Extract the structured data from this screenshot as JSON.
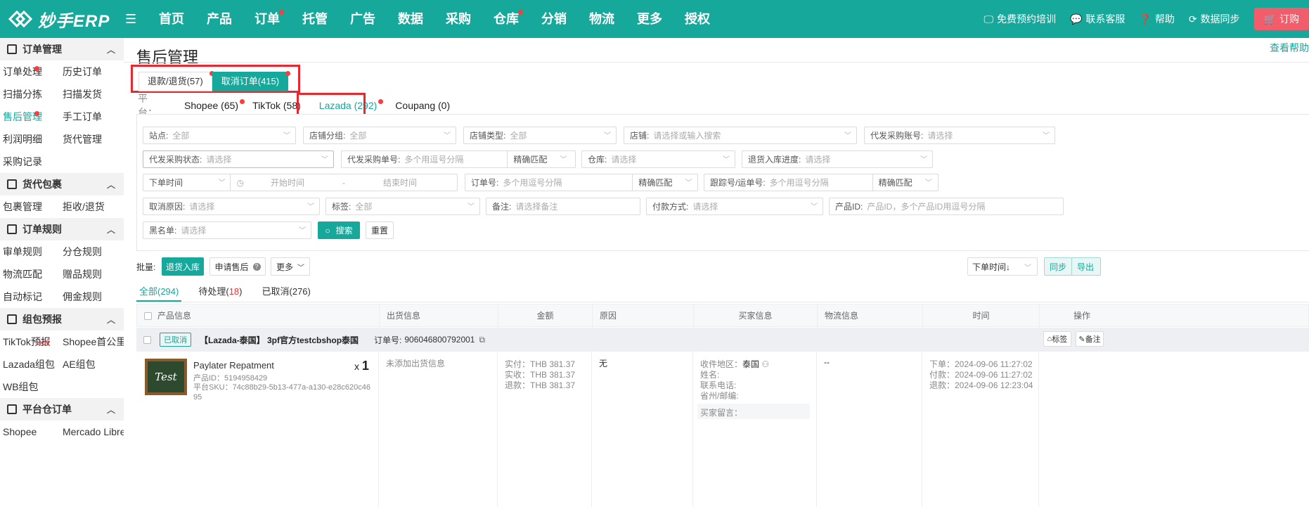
{
  "app": {
    "logo_text": "妙手ERP"
  },
  "nav": [
    "首页",
    "产品",
    "订单",
    "托管",
    "广告",
    "数据",
    "采购",
    "仓库",
    "分销",
    "物流",
    "更多",
    "授权"
  ],
  "top_right": {
    "training": "免费预约培训",
    "service": "联系客服",
    "help": "帮助",
    "sync": "数据同步",
    "order": "订购"
  },
  "sidebar": {
    "sections": [
      {
        "title": "订单管理",
        "items": [
          "订单处理",
          "历史订单",
          "扫描分拣",
          "扫描发货",
          "售后管理",
          "手工订单",
          "利润明细",
          "货代管理",
          "采购记录"
        ]
      },
      {
        "title": "货代包裹",
        "items": [
          "包裹管理",
          "拒收/退货"
        ]
      },
      {
        "title": "订单规则",
        "items": [
          "审单规则",
          "分仓规则",
          "物流匹配",
          "赠品规则",
          "自动标记",
          "佣金规则"
        ]
      },
      {
        "title": "组包预报",
        "items": [
          "TikTok预报",
          "Shopee首公里",
          "Lazada组包",
          "AE组包",
          "WB组包"
        ]
      },
      {
        "title": "平台仓订单",
        "items": [
          "Shopee",
          "Mercado Libre"
        ]
      }
    ],
    "hot_tag": "HOT"
  },
  "page": {
    "title": "售后管理",
    "help_link": "查看帮助"
  },
  "top_tabs": [
    "退款/退货(57)",
    "取消订单(415)"
  ],
  "platform": {
    "label": "平　　台：",
    "tabs": [
      "Shopee (65)",
      "TikTok (58)",
      "Lazada (292)",
      "Coupang (0)"
    ]
  },
  "filters": {
    "site": {
      "label": "站点:",
      "value": "全部"
    },
    "shop_group": {
      "label": "店铺分组:",
      "value": "全部"
    },
    "shop_type": {
      "label": "店铺类型:",
      "value": "全部"
    },
    "shop": {
      "label": "店铺:",
      "value": "请选择或输入搜索"
    },
    "proxy_account": {
      "label": "代发采购账号:",
      "value": "请选择"
    },
    "proxy_status": {
      "label": "代发采购状态:",
      "value": "请选择"
    },
    "proxy_order_no": {
      "label": "代发采购单号:",
      "value": "多个用逗号分隔",
      "match": "精确匹配"
    },
    "warehouse": {
      "label": "仓库:",
      "value": "请选择"
    },
    "return_progress": {
      "label": "退货入库进度:",
      "value": "请选择"
    },
    "time_type": "下单时间",
    "start_time": "开始时间",
    "range_sep": "-",
    "end_time": "结束时间",
    "order_no": {
      "label": "订单号:",
      "value": "多个用逗号分隔",
      "match": "精确匹配"
    },
    "tracking_no": {
      "label": "跟踪号/运单号:",
      "value": "多个用逗号分隔",
      "match": "精确匹配"
    },
    "cancel_reason": {
      "label": "取消原因:",
      "value": "请选择"
    },
    "tag": {
      "label": "标签:",
      "value": "全部"
    },
    "remark": {
      "label": "备注:",
      "value": "请选择备注"
    },
    "payment": {
      "label": "付款方式:",
      "value": "请选择"
    },
    "product_id": {
      "label": "产品ID:",
      "value": "产品ID，多个产品ID用逗号分隔"
    },
    "blacklist": {
      "label": "黑名单:",
      "value": "请选择"
    },
    "search_btn": "搜索",
    "reset_btn": "重置"
  },
  "batch": {
    "label": "批量:",
    "return_stock": "退货入库",
    "apply_after_sale": "申请售后",
    "more": "更多",
    "sort": "下单时间↓",
    "sync": "同步",
    "export": "导出"
  },
  "list_tabs": {
    "all": "全部(294)",
    "pending_label": "待处理(",
    "pending_count": "18",
    "pending_close": ")",
    "cancelled": "已取消(276)"
  },
  "table_headers": [
    "产品信息",
    "出货信息",
    "金额",
    "原因",
    "买家信息",
    "物流信息",
    "时间",
    "操作"
  ],
  "order": {
    "status": "已取消",
    "shop": "【Lazada-泰国】 3pf官方testcbshop泰国",
    "order_no_label": "订单号:",
    "order_no": "906046800792001",
    "tag_btn": "标签",
    "remark_btn": "备注",
    "product_name": "Paylater Repatment",
    "thumbnail_text": "Test",
    "product_id": "产品ID：5194958429",
    "sku_label": "平台SKU：",
    "sku_value": "74c88b29-5b13-477a-a130-e28c620c4695",
    "qty_prefix": "x",
    "qty": "1",
    "shipping": "未添加出货信息",
    "amounts": [
      "实付：THB 381.37",
      "实收：THB 381.37",
      "退款：THB 381.37"
    ],
    "reason": "无",
    "buyer": {
      "region_label": "收件地区：",
      "region": "泰国",
      "name": "姓名:",
      "phone": "联系电话:",
      "province": "省州/邮编:",
      "message": "买家留言："
    },
    "logistics": "--",
    "times": [
      "下单：2024-09-06 11:27:02",
      "付款：2024-09-06 11:27:02",
      "退款：2024-09-06 12:23:04"
    ]
  }
}
